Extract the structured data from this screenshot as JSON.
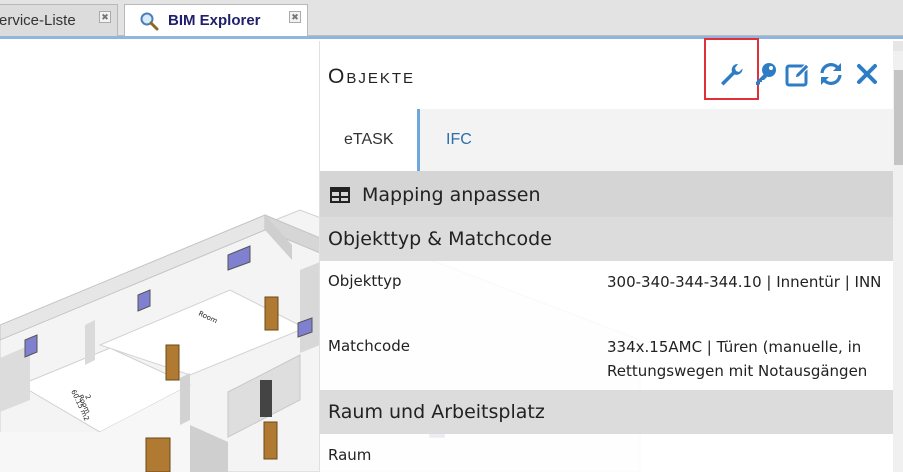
{
  "tabs": [
    {
      "label": "ervice-Liste",
      "close": "✖"
    },
    {
      "label": "BIM Explorer",
      "close": "✖"
    }
  ],
  "panel": {
    "title": "Objekte",
    "toolbar": {
      "wrench": "wrench-icon",
      "key": "key-icon",
      "edit": "edit-icon",
      "refresh": "refresh-icon",
      "close": "close-icon"
    },
    "subtabs": [
      {
        "label": "eTASK",
        "active": true
      },
      {
        "label": "IFC",
        "active": false
      }
    ],
    "mapping_label": "Mapping anpassen",
    "section_objekttyp": "Objekttyp & Matchcode",
    "properties": [
      {
        "label": "Objekttyp",
        "value": "300-340-344-344.10 | Innentür | INN"
      },
      {
        "label": "Matchcode",
        "value": "334x.15AMC | Türen (manuelle, in Rettungswegen mit Notausgängen"
      }
    ],
    "section_raum": "Raum und Arbeitsplatz",
    "raum_label": "Raum"
  },
  "scene_labels": {
    "room_small": "Room",
    "room_big_line1": "2",
    "room_big_line2": "Room",
    "room_big_line3": "60.15 m2"
  },
  "colors": {
    "accent": "#2e7dc4",
    "highlight": "#e0303a",
    "tab_active_border": "#6fa6dc"
  }
}
